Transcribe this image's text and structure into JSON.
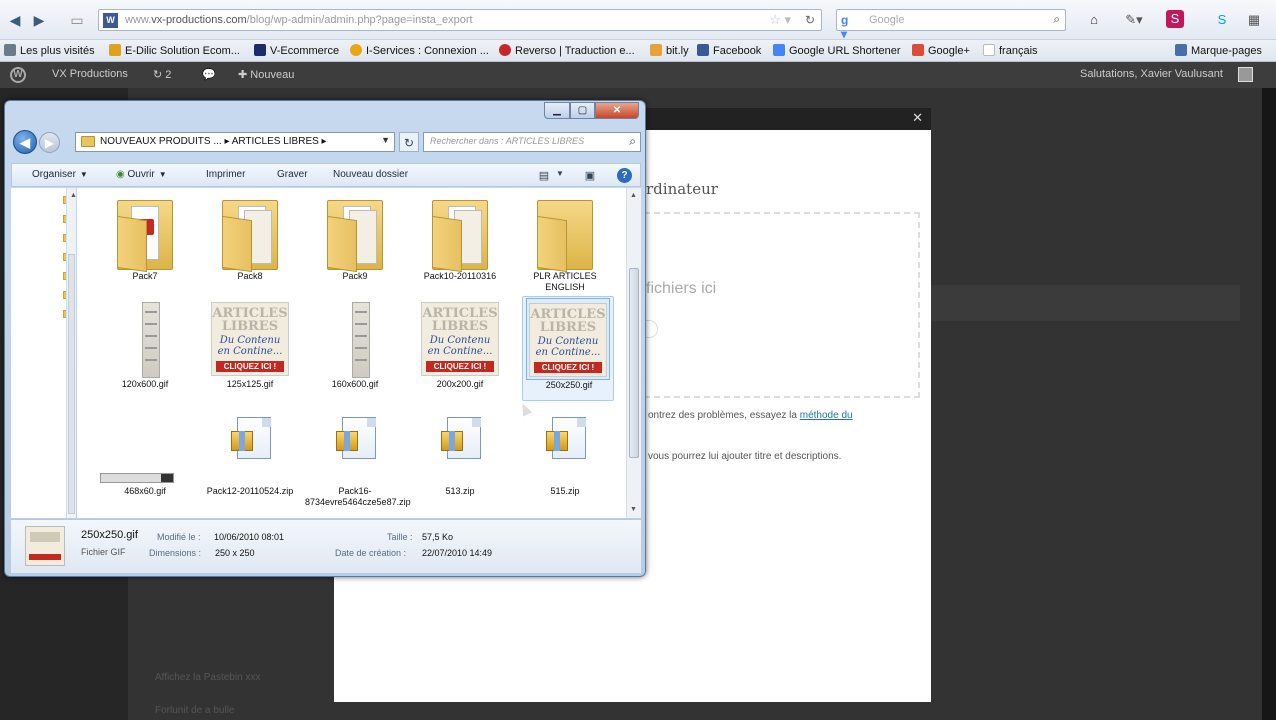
{
  "browser": {
    "url_domain": "vx-productions.com",
    "url_path": "/blog/wp-admin/admin.php?page=insta_export",
    "url_prefix": "www.",
    "search_placeholder": "Google"
  },
  "bookmarks": [
    {
      "label": "Les plus visités",
      "icon": "gear-icon",
      "color": "#6b7b8c"
    },
    {
      "label": "E-Dilic Solution Ecom...",
      "icon": "star-icon",
      "color": "#e0a020"
    },
    {
      "label": "V-Ecommerce",
      "icon": "v-logo-icon",
      "color": "#1b2b6b"
    },
    {
      "label": "I-Services : Connexion ...",
      "icon": "coin-icon",
      "color": "#e6a817"
    },
    {
      "label": "Reverso | Traduction e...",
      "icon": "reverso-icon",
      "color": "#c62828"
    },
    {
      "label": "bit.ly",
      "icon": "fish-icon",
      "color": "#e8a23a"
    },
    {
      "label": "Facebook",
      "icon": "facebook-icon",
      "color": "#3b5998"
    },
    {
      "label": "Google URL Shortener",
      "icon": "google-icon",
      "color": "#4285f4"
    },
    {
      "label": "Google+",
      "icon": "google-plus-icon",
      "color": "#dd4b39"
    },
    {
      "label": "français",
      "icon": "page-icon",
      "color": "#dddddd"
    },
    {
      "label": "Marque-pages",
      "icon": "bookmark-icon",
      "color": "#4a6fa5"
    }
  ],
  "wp_bar": {
    "site_name": "VX Productions",
    "updates_count": "2",
    "new_label": "Nouveau",
    "greeting": "Salutations, Xavier Vaulusant"
  },
  "page": {
    "bottom_item_a": "Affichez la Pastebin xxx",
    "bottom_item_b": "Forlunit de a bulle"
  },
  "modal": {
    "title": "rdinateur",
    "drop_text": "fichiers ici",
    "note1_text": "ontrez des problèmes, essayez la ",
    "note1_link": "méthode du",
    "note2_text": "vous pourrez lui ajouter titre et descriptions."
  },
  "explorer": {
    "address_text": "NOUVEAUX PRODUITS ...  ▸  ARTICLES LIBRES  ▸",
    "search_placeholder": "Rechercher dans : ARTICLES LIBRES",
    "commands": {
      "organize": "Organiser",
      "open": "Ouvrir",
      "print": "Imprimer",
      "burn": "Graver",
      "new_folder": "Nouveau dossier"
    },
    "files": [
      {
        "name": "Pack7",
        "kind": "folder-pdf"
      },
      {
        "name": "Pack8",
        "kind": "folder"
      },
      {
        "name": "Pack9",
        "kind": "folder"
      },
      {
        "name": "Pack10-20110316",
        "kind": "folder"
      },
      {
        "name": "PLR ARTICLES ENGLISH",
        "kind": "folder-empty"
      },
      {
        "name": "120x600.gif",
        "kind": "vertical-banner"
      },
      {
        "name": "125x125.gif",
        "kind": "banner"
      },
      {
        "name": "160x600.gif",
        "kind": "vertical-banner"
      },
      {
        "name": "200x200.gif",
        "kind": "banner"
      },
      {
        "name": "250x250.gif",
        "kind": "banner",
        "selected": true
      },
      {
        "name": "468x60.gif",
        "kind": "horizontal-banner"
      },
      {
        "name": "Pack12-20110524.zip",
        "kind": "zip"
      },
      {
        "name": "Pack16-8734evre5464cze5e87.zip",
        "kind": "zip"
      },
      {
        "name": "513.zip",
        "kind": "zip"
      },
      {
        "name": "515.zip",
        "kind": "zip"
      }
    ],
    "banner_text": {
      "line1": "ARTICLES",
      "line2": "LIBRES",
      "line3": "Du Contenu en Contine...",
      "cta": "CLIQUEZ ICI !"
    },
    "details": {
      "name": "250x250.gif",
      "type": "Fichier GIF",
      "modified_label": "Modifié le :",
      "modified_value": "10/06/2010 08:01",
      "dimensions_label": "Dimensions :",
      "dimensions_value": "250 x 250",
      "size_label": "Taille :",
      "size_value": "57,5 Ko",
      "created_label": "Date de création :",
      "created_value": "22/07/2010 14:49"
    }
  }
}
